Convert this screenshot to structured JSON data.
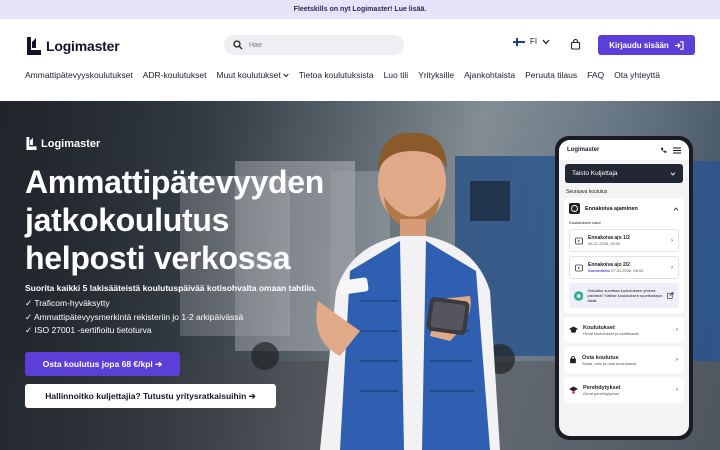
{
  "topbar": {
    "text": "Fleetskills on nyt Logimaster! Lue lisää."
  },
  "header": {
    "logo_text": "Logimaster",
    "search_placeholder": "Hae",
    "lang_code": "FI",
    "login_label": "Kirjaudu sisään"
  },
  "nav": {
    "items": [
      "Ammattipätevyyskoulutukset",
      "ADR-koulutukset",
      "Muut koulutukset",
      "Tietoa koulutuksista",
      "Luo tili",
      "Yrityksille",
      "Ajankohtaista",
      "Peruuta tilaus",
      "FAQ",
      "Ota yhteyttä"
    ]
  },
  "hero": {
    "logo_text": "Logimaster",
    "headline_line1": "Ammattipätevyyden",
    "headline_line2": "jatkokoulutus",
    "headline_line3": "helposti verkossa",
    "subtitle": "Suorita kaikki 5 lakisääteistä koulutuspäivää kotisohvalta omaan tahtiin.",
    "checks": [
      "✓ Traficom-hyväksytty",
      "✓ Ammattipätevyysmerkintä rekisteriin jo 1-2 arkipäivässä",
      "✓ ISO 27001 -sertifioitu tietoturva"
    ],
    "cta_primary": "Osta koulutus jopa 68 €/kpl ➔",
    "cta_secondary": "Hallinnoitko kuljettajia? Tutustu yritysratkaisuihin ➔"
  },
  "phone": {
    "brand": "Logimaster",
    "user": "Taisto Kuljettaja",
    "section": "Seuraava koulutus",
    "course_title": "Ennakoiva ajaminen",
    "parts_label": "Koulutuksen osiot",
    "part1_title": "Ennakoiva ajo 1/2",
    "part1_date": "06.01.2026, 08:00",
    "part2_title": "Ennakoiva ajo 2/2",
    "part2_status": "Suunniteltu",
    "part2_date": "07.01.2026, 08:00",
    "info_text": "Haluatko suorittaa koulutuksen yhtenä päivänä? Valitse koulutuksen suoritustapa tästä.",
    "menu1_title": "Koulutukset",
    "menu1_sub": "Omat koulutukset ja sertifikaatit",
    "menu2_title": "Osta koulutus",
    "menu2_sub": "Selaa, ostu ja osta koulutuksia",
    "menu3_title": "Perehdytykset",
    "menu3_sub": "Omat perehdytykset"
  }
}
